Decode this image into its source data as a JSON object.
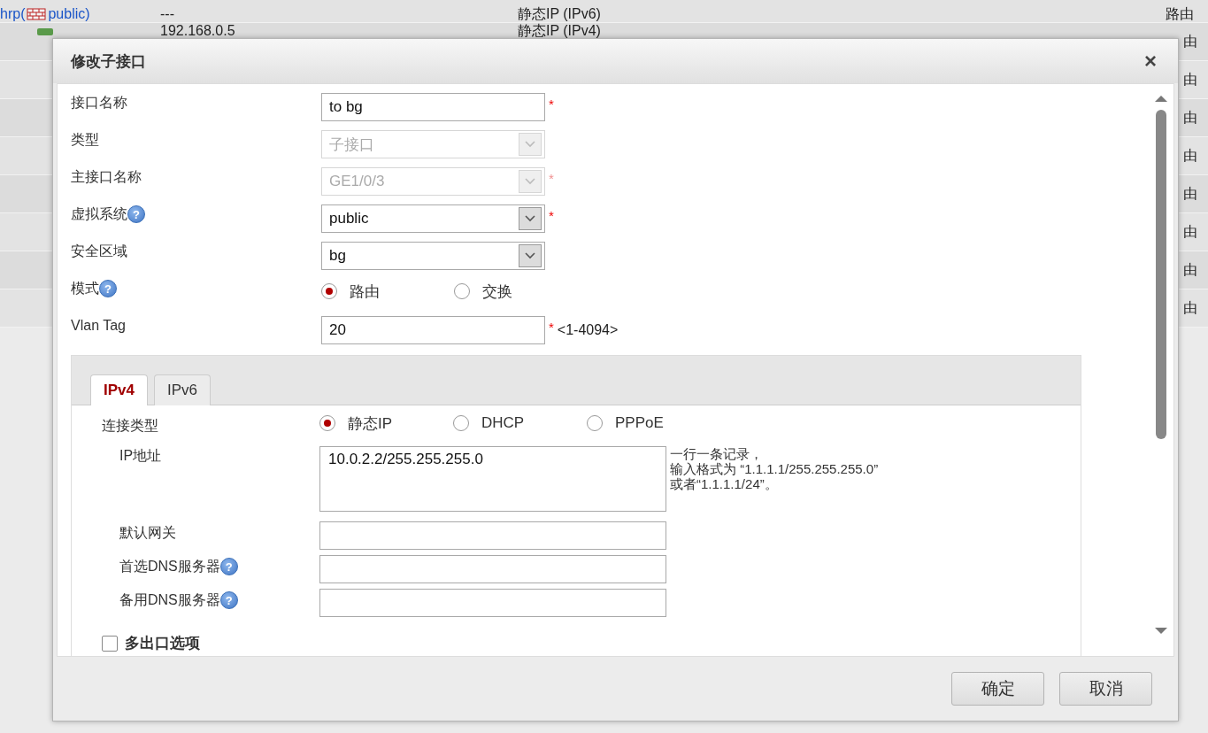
{
  "background_table": {
    "rows": [
      {
        "link_before": "hrp(",
        "link_after": "public)",
        "column_2": "---",
        "column_3": "静态IP (IPv6)",
        "column_4": "路由"
      },
      {
        "icon": true,
        "column_2": "192.168.0.5",
        "column_3": "静态IP (IPv4)",
        "column_4": "由"
      },
      {
        "column_4": "由"
      },
      {
        "column_4": "由"
      },
      {
        "column_4": "由"
      },
      {
        "column_4": "由"
      },
      {
        "column_4": "由"
      },
      {
        "column_4": "由"
      },
      {
        "column_4": "由"
      }
    ]
  },
  "dialog": {
    "title": "修改子接口",
    "close": "×",
    "fields": [
      {
        "kind": "text",
        "label": "接口名称",
        "value": "to bg",
        "required_mark": "*",
        "disabled": false
      },
      {
        "kind": "select",
        "label": "类型",
        "value": "子接口",
        "disabled": true
      },
      {
        "kind": "select",
        "label": "主接口名称",
        "value": "GE1/0/3",
        "required_mark": "*",
        "disabled": true
      },
      {
        "kind": "select",
        "label": "虚拟系统",
        "help": "?",
        "value": "public",
        "required_mark": "*",
        "disabled": false
      },
      {
        "kind": "select",
        "label": "安全区域",
        "value": "bg",
        "disabled": false
      },
      {
        "kind": "radio",
        "label": "模式",
        "help": "?",
        "options": [
          {
            "label": "路由",
            "selected": true
          },
          {
            "label": "交换",
            "selected": false
          }
        ]
      },
      {
        "kind": "text",
        "label": "Vlan Tag",
        "value": "20",
        "required_mark": "*",
        "disabled": false,
        "hint": "<1-4094>"
      }
    ],
    "tabs": [
      {
        "label": "IPv4",
        "selected": true
      },
      {
        "label": "IPv6",
        "selected": false
      }
    ],
    "ipv4": {
      "connection_type": {
        "label": "连接类型",
        "options": [
          {
            "label": "静态IP",
            "selected": true
          },
          {
            "label": "DHCP",
            "selected": false
          },
          {
            "label": "PPPoE",
            "selected": false
          }
        ]
      },
      "ip_address": {
        "label": "IP地址",
        "value": "10.0.2.2/255.255.255.0",
        "note": [
          "一行一条记录，",
          "输入格式为 “1.1.1.1/255.255.255.0”",
          "或者“1.1.1.1/24”。"
        ]
      },
      "inputs": [
        {
          "label": "默认网关"
        },
        {
          "label": "首选DNS服务器",
          "help": "?"
        },
        {
          "label": "备用DNS服务器",
          "help": "?"
        }
      ],
      "multi_exit": {
        "label": "多出口选项",
        "checked": false
      }
    },
    "buttons": [
      "确定",
      "取消"
    ]
  }
}
